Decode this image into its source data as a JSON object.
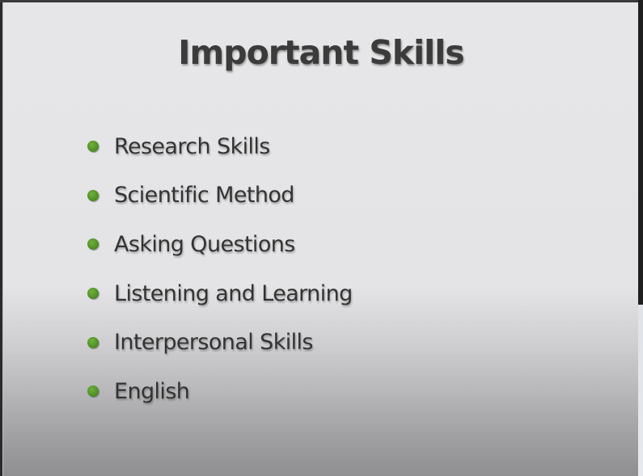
{
  "slide": {
    "title": "Important Skills",
    "bullets": [
      {
        "label": "Research Skills"
      },
      {
        "label": "Scientific Method"
      },
      {
        "label": "Asking Questions"
      },
      {
        "label": "Listening and Learning"
      },
      {
        "label": "Interpersonal Skills"
      },
      {
        "label": "English"
      }
    ]
  },
  "colors": {
    "bullet": "#4b8a24",
    "title_text": "#3b3b3b",
    "body_text": "#333333",
    "slide_background": "#e6e6e8"
  },
  "icons": {
    "bullet": "green-bullet-icon"
  }
}
